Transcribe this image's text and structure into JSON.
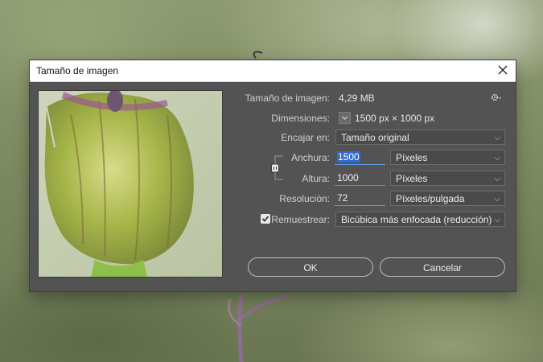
{
  "dialog": {
    "title": "Tamaño de imagen",
    "size_label": "Tamaño de imagen:",
    "size_value": "4,29 MB",
    "dimensions_label": "Dimensiones:",
    "dimensions_value": "1500 px × 1000 px",
    "fit_label": "Encajar en:",
    "fit_value": "Tamaño original",
    "width_label": "Anchura:",
    "width_value": "1500",
    "width_unit": "Píxeles",
    "height_label": "Altura:",
    "height_value": "1000",
    "height_unit": "Píxeles",
    "resolution_label": "Resolución:",
    "resolution_value": "72",
    "resolution_unit": "Píxeles/pulgada",
    "resample_label": "Remuestrear:",
    "resample_checked": true,
    "resample_value": "Bicúbica más enfocada (reducción)",
    "ok_label": "OK",
    "cancel_label": "Cancelar"
  },
  "icons": {
    "close": "close-icon",
    "settings": "gear-icon",
    "dropdown": "chevron-down-icon",
    "link": "chain-link-icon",
    "checkbox": "checkmark-icon"
  },
  "colors": {
    "dialog_bg": "#535353",
    "selection": "#2f6bd3"
  }
}
